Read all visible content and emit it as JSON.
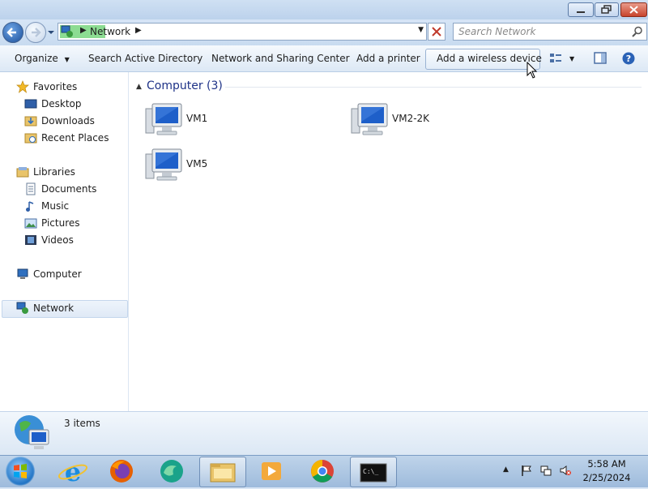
{
  "window": {
    "title": "",
    "controls": [
      "minimize",
      "maximize",
      "close"
    ]
  },
  "address_bar": {
    "breadcrumb": [
      "Network"
    ],
    "icon": "network-icon"
  },
  "search": {
    "placeholder": "Search Network"
  },
  "toolbar": {
    "organize": "Organize",
    "search_ad": "Search Active Directory",
    "network_center": "Network and Sharing Center",
    "add_printer": "Add a printer",
    "add_wireless": "Add a wireless device"
  },
  "navigation": {
    "favorites": {
      "label": "Favorites",
      "items": [
        "Desktop",
        "Downloads",
        "Recent Places"
      ]
    },
    "libraries": {
      "label": "Libraries",
      "items": [
        "Documents",
        "Music",
        "Pictures",
        "Videos"
      ]
    },
    "computer": "Computer",
    "network": "Network",
    "selected": "Network"
  },
  "content": {
    "group_title": "Computer (3)",
    "computers": [
      "VM1",
      "VM2-2K",
      "VM5"
    ]
  },
  "details": {
    "count": "3 items"
  },
  "taskbar": {
    "apps": [
      "internet-explorer",
      "firefox",
      "edge",
      "file-explorer",
      "media-player",
      "chrome",
      "command-prompt"
    ],
    "time": "5:58 AM",
    "date": "2/25/2024"
  },
  "colors": {
    "group_title": "#1e3287",
    "selection": "#dfe9f6",
    "address_highlight": "#3fc44a"
  }
}
